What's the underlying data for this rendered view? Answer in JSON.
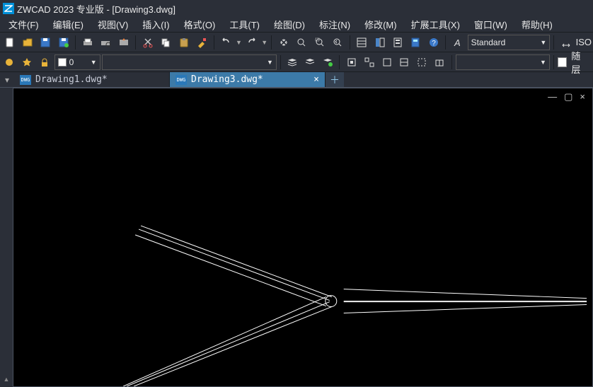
{
  "title": {
    "app": "ZWCAD 2023 专业版",
    "doc": "[Drawing3.dwg]"
  },
  "menu": [
    "文件(F)",
    "编辑(E)",
    "视图(V)",
    "插入(I)",
    "格式(O)",
    "工具(T)",
    "绘图(D)",
    "标注(N)",
    "修改(M)",
    "扩展工具(X)",
    "窗口(W)",
    "帮助(H)"
  ],
  "style_dropdown": "Standard",
  "iso_label": "ISO",
  "layer": {
    "value": "0"
  },
  "second_dropdown_long": "",
  "bylayer_label": "随层",
  "tabs": [
    {
      "name": "Drawing1.dwg*",
      "active": false
    },
    {
      "name": "Drawing3.dwg*",
      "active": true
    }
  ],
  "canvas_controls": {
    "min": "—",
    "max": "▢",
    "close": "×"
  }
}
